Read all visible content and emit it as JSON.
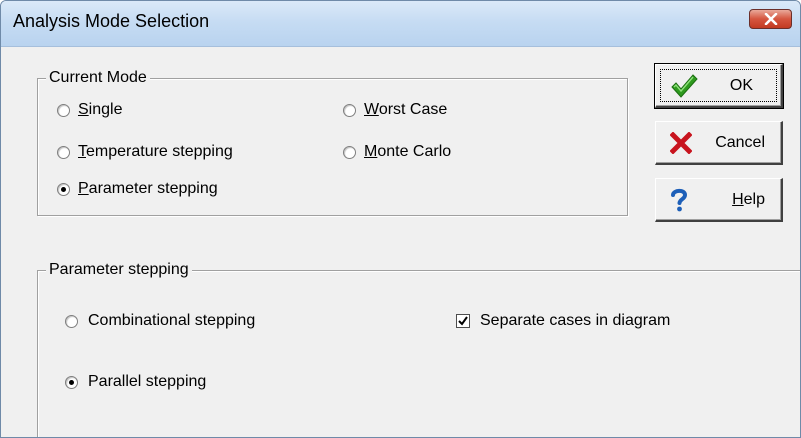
{
  "window": {
    "title": "Analysis Mode Selection"
  },
  "current_mode": {
    "legend": "Current Mode",
    "options": {
      "single": {
        "pre": "",
        "accel": "S",
        "post": "ingle",
        "selected": false
      },
      "temperature": {
        "pre": "",
        "accel": "T",
        "post": "emperature stepping",
        "selected": false
      },
      "parameter": {
        "pre": "",
        "accel": "P",
        "post": "arameter stepping",
        "selected": true
      },
      "worst_case": {
        "pre": "",
        "accel": "W",
        "post": "orst Case",
        "selected": false
      },
      "monte_carlo": {
        "pre": "",
        "accel": "M",
        "post": "onte Carlo",
        "selected": false
      }
    }
  },
  "parameter_stepping": {
    "legend": "Parameter stepping",
    "combinational": {
      "label": "Combinational stepping",
      "selected": false
    },
    "parallel": {
      "label": "Parallel stepping",
      "selected": true
    },
    "separate_cases": {
      "label": "Separate cases in diagram",
      "checked": true
    }
  },
  "buttons": {
    "ok": {
      "label": "OK",
      "icon": "checkmark-icon",
      "color": "#2e9a1e"
    },
    "cancel": {
      "label": "Cancel",
      "icon": "red-x-icon",
      "color": "#c8141e"
    },
    "help": {
      "pre": "",
      "accel": "H",
      "post": "elp",
      "icon": "question-icon",
      "color": "#1d5fb8"
    }
  },
  "colors": {
    "title_gradient_top": "#dbe9f8",
    "title_gradient_bottom": "#b9d3ef",
    "close_button": "#c23a22",
    "dialog_bg": "#f0f0f0"
  }
}
